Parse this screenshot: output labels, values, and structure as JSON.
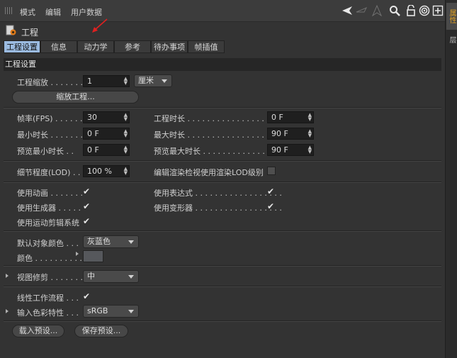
{
  "menubar": {
    "items": [
      "模式",
      "编辑",
      "用户数据"
    ]
  },
  "project": {
    "title": "工程"
  },
  "tabs": [
    "工程设置",
    "信息",
    "动力学",
    "参考",
    "待办事项",
    "帧插值"
  ],
  "section": {
    "title": "工程设置"
  },
  "scale": {
    "label": "工程缩放 . . . . . . . .",
    "value": "1",
    "unit": "厘米",
    "button": "缩放工程..."
  },
  "timing": {
    "fps_label": "帧率(FPS) . . . . . .",
    "fps_value": "30",
    "min_time_label": "最小时长 . . . . . . . .",
    "min_time_value": "0 F",
    "preview_min_label": "预览最小时长 . .",
    "preview_min_value": "0 F",
    "project_time_label": "工程时长 . . . . . . . . . . . . . . . . . . .",
    "project_time_value": "0 F",
    "max_time_label": "最大时长 . . . . . . . . . . . . . . . . . . .",
    "max_time_value": "90 F",
    "preview_max_label": "预览最大时长 . . . . . . . . . . . . . . .",
    "preview_max_value": "90 F"
  },
  "lod": {
    "label": "细节程度(LOD) . .",
    "value": "100 %",
    "render_lod_label": "编辑渲染检视使用渲染LOD级别"
  },
  "usage": {
    "animation": "使用动画 . . . . . . .",
    "generators": "使用生成器 . . . . .",
    "motion_clip": "使用运动剪辑系统",
    "expressions": "使用表达式 . . . . . . . . . . . . . . . . . .",
    "deformers": "使用变形器 . . . . . . . . . . . . . . . . . .",
    "check_mark": "✔"
  },
  "color": {
    "default_label": "默认对象颜色 . . .",
    "default_value": "灰蓝色",
    "color_label": "颜色 . . . . . . . . . ."
  },
  "view_clip": {
    "label": "视图修剪 . . . . . . . .",
    "value": "中"
  },
  "linear": {
    "workflow_label": "线性工作流程 . . .",
    "profile_label": "输入色彩特性 . . .",
    "profile_value": "sRGB"
  },
  "presets": {
    "load": "载入预设...",
    "save": "保存预设..."
  },
  "right_tabs": [
    "属性",
    "层"
  ],
  "icons": {
    "spin": "▲▼",
    "tools": [
      "arrow-left-icon",
      "arrow-outline-icon",
      "up-icon",
      "search-icon",
      "lock-icon",
      "target-icon",
      "new-panel-icon"
    ]
  },
  "colors": {
    "active_tab": "#9bbbe0",
    "annotation_arrow": "#e02020",
    "right_tab_active": "#e0a020"
  }
}
